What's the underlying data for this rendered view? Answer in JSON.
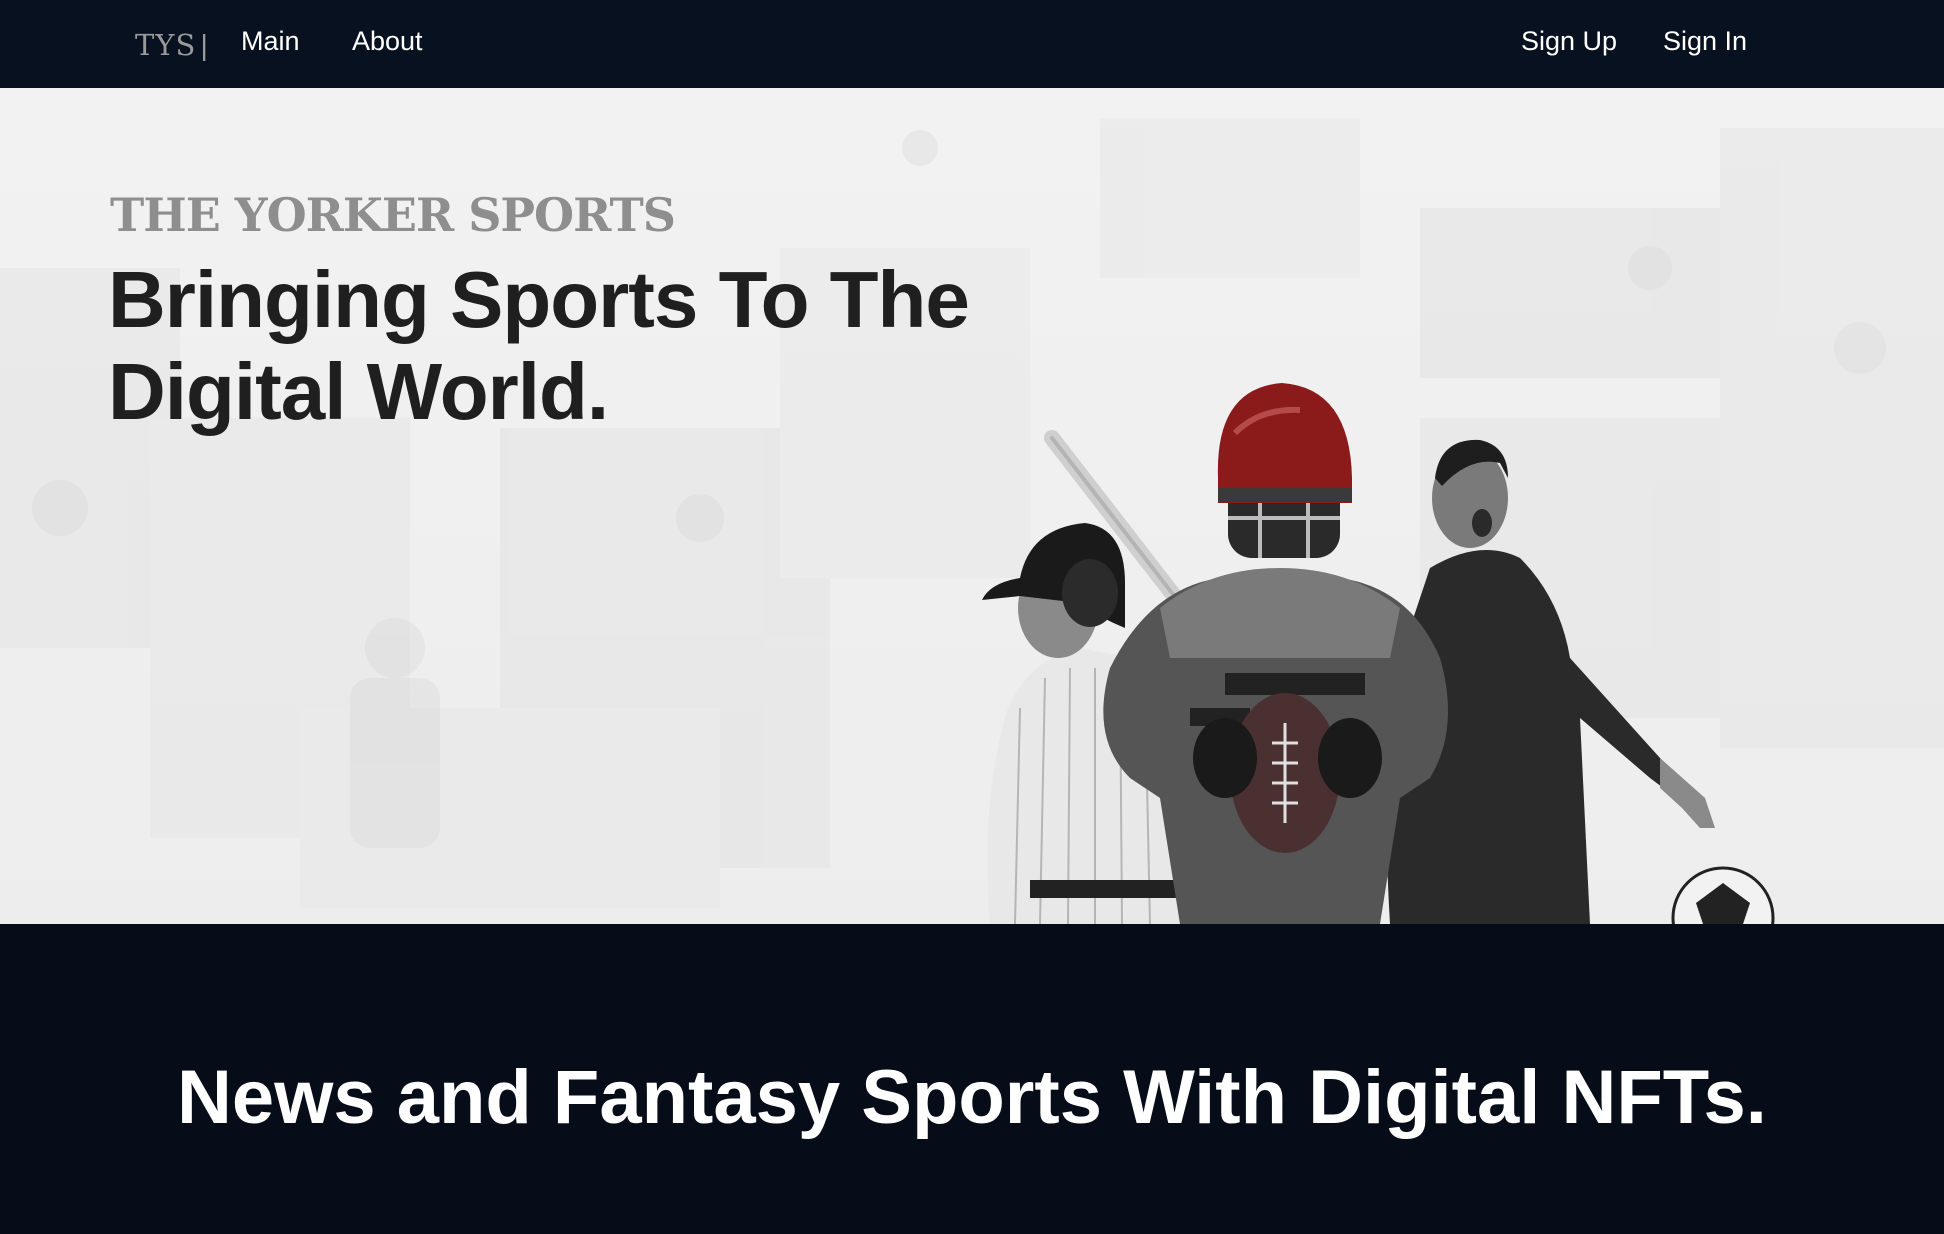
{
  "nav": {
    "logo": "TYS",
    "separator": "|",
    "links": [
      {
        "label": "Main"
      },
      {
        "label": "About"
      }
    ],
    "auth": {
      "signup_label": "Sign Up",
      "signin_label": "Sign In"
    }
  },
  "hero": {
    "brand": "THE YORKER SPORTS",
    "headline": "Bringing Sports To The Digital World.",
    "image": "athletes-collage (baseball player, football player with red helmet, soccer player)"
  },
  "tagline": {
    "text": "News and Fantasy Sports With Digital NFTs."
  },
  "colors": {
    "nav_bg": "#081120",
    "section_bg": "#070d18",
    "hero_bg": "#f0f0f0",
    "helmet_accent": "#8b1a1a"
  }
}
